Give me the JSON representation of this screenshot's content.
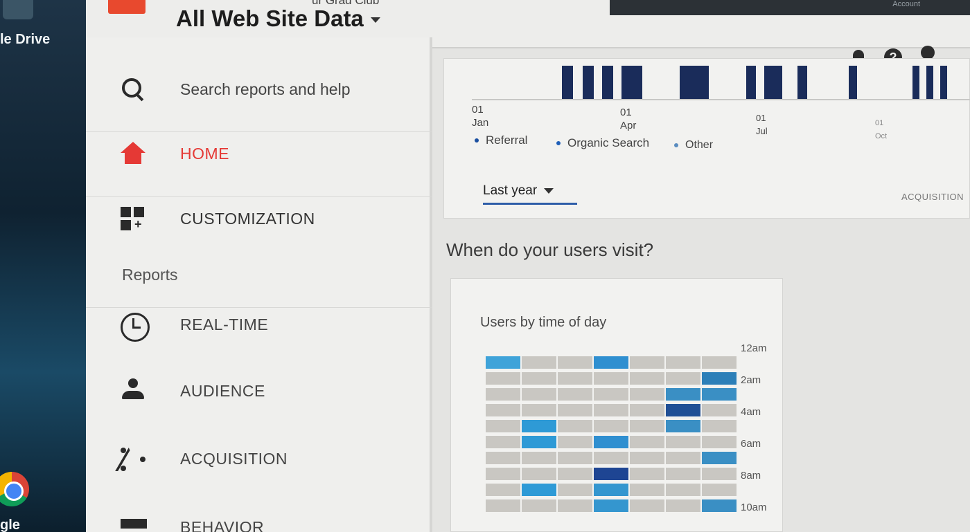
{
  "desktop": {
    "drive_label": "le Drive",
    "google_label": "gle"
  },
  "header": {
    "account_name": "ur Grad Club",
    "property_title": "All Web Site Data",
    "account_link": "Account"
  },
  "sidebar": {
    "search_label": "Search reports and help",
    "home_label": "HOME",
    "customization_label": "CUSTOMIZATION",
    "reports_heading": "Reports",
    "items": [
      {
        "label": "REAL-TIME"
      },
      {
        "label": "AUDIENCE"
      },
      {
        "label": "ACQUISITION"
      },
      {
        "label": "BEHAVIOR"
      }
    ]
  },
  "timeline": {
    "ticks": [
      {
        "day": "01",
        "month": "Jan"
      },
      {
        "day": "01",
        "month": "Apr"
      },
      {
        "day": "01",
        "month": "Jul"
      },
      {
        "day": "01",
        "month": "Oct"
      }
    ],
    "legend": [
      {
        "label": "Referral",
        "color": "#1a4fa0"
      },
      {
        "label": "Organic Search",
        "color": "#1e5fb8"
      },
      {
        "label": "Other",
        "color": "#5a8cbf"
      }
    ],
    "date_range": "Last year",
    "acquisition_tab": "ACQUISITION"
  },
  "users_visit": {
    "heading": "When do your users visit?",
    "card_title": "Users by time of day",
    "hour_labels": [
      "12am",
      "2am",
      "4am",
      "6am",
      "8am",
      "10am"
    ]
  },
  "colors": {
    "accent_red": "#e53935",
    "bar_navy": "#1a2c5a",
    "dropdown_underline": "#2e5da8"
  }
}
